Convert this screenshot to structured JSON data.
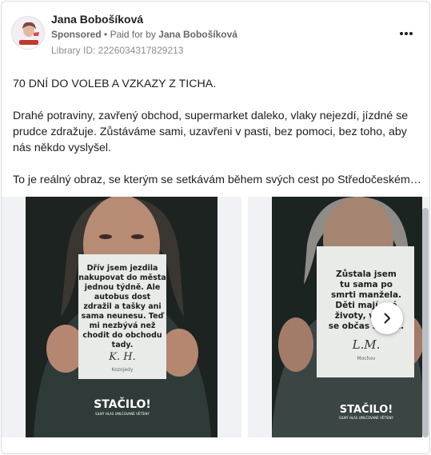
{
  "advertiser": {
    "name": "Jana Bobošíková",
    "sponsored_label": "Sponsored",
    "separator": "•",
    "paid_for_prefix": "Paid for by",
    "paid_for_name": "Jana Bobošíková",
    "library_id": "Library ID: 2226034317829213"
  },
  "post": {
    "headline": "70 DNÍ DO VOLEB A VZKAZY Z TICHA.",
    "paragraph_1": "Drahé potraviny, zavřený obchod, supermarket daleko, vlaky nejezdí, jízdné se prudce zdražuje. Zůstáváme sami, uzavřeni v pasti, bez pomoci, bez toho, aby nás někdo vyslyšel.",
    "paragraph_2": "To je reálný obraz, se kterým se setkávám během svých cest po Středočeském…"
  },
  "carousel": {
    "slides": [
      {
        "sign_lines": [
          "Dřív jsem jezdila",
          "nakupovat do města",
          "jednou týdně. Ale",
          "autobus dost",
          "zdražil a tašky ani",
          "sama neunesu. Teď",
          "mi nezbývá než",
          "chodit do obchodu",
          "tady."
        ],
        "signature": "K. H.",
        "location": "Kozojedy",
        "brand": "STAČILO!",
        "tagline": "SILNÝ HLAS UMLČOVANÉ VĚTŠINY"
      },
      {
        "sign_lines": [
          "Zůstala jsem",
          "tu sama po",
          "smrti manžela.",
          "Děti mají své",
          "životy, vídám",
          "se občas s nimi."
        ],
        "signature": "L.M.",
        "location": "Mochov",
        "brand": "STAČILO!",
        "tagline": "SILNÝ HLAS UMLČOVANÉ VĚTŠINY"
      }
    ],
    "next_icon": "chevron-right-icon",
    "more_icon": "more-horizontal-icon"
  },
  "colors": {
    "secondary_text": "#65676b",
    "photo_background": "#1d2320",
    "sign_paper": "#e9ebe8",
    "slide_frame": "#f0f2f5"
  }
}
